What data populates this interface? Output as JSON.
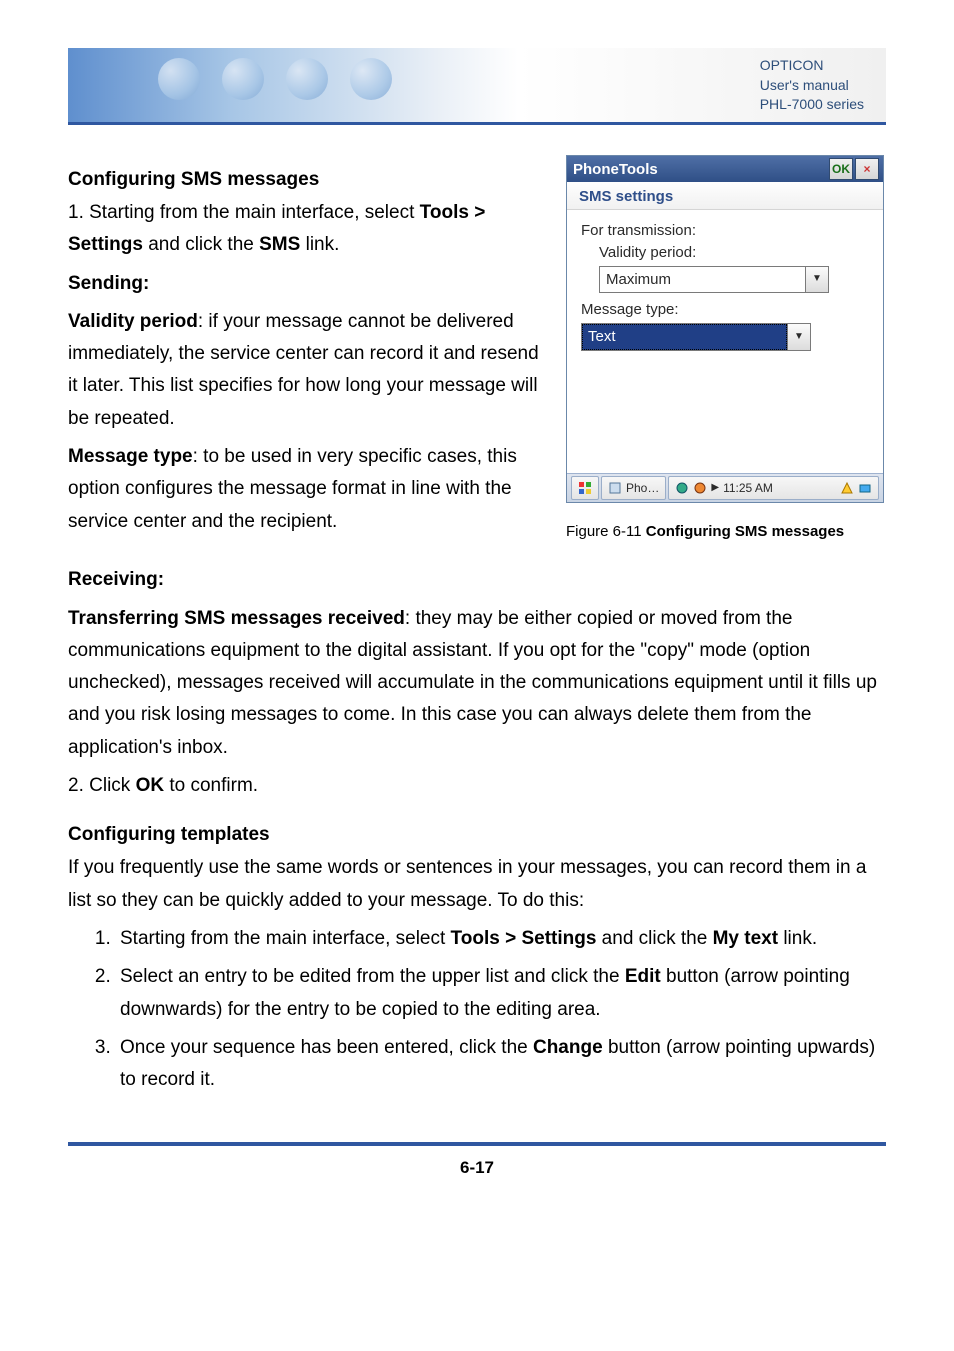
{
  "banner": {
    "line1": "OPTICON",
    "line2": "User's manual",
    "line3": "PHL-7000 series"
  },
  "s1": {
    "heading": "Configuring SMS messages",
    "p1a": "1. Starting from the main interface, select ",
    "p1b": "Tools > Settings",
    "p1c": " and click the ",
    "p1d": "SMS",
    "p1e": " link.",
    "sending": "Sending:",
    "vp_label": "Validity period",
    "vp_text": ": if your message cannot be delivered immediately, the service center can record it and resend it later. This list specifies for how long your message will be repeated.",
    "mt_label": "Message type",
    "mt_text": ": to be used in very specific cases, this option configures the message format in line with the service center and the recipient."
  },
  "shot": {
    "title": "PhoneTools",
    "ok": "OK",
    "close": "×",
    "sub": "SMS settings",
    "for_trans": "For transmission:",
    "validity": "Validity period:",
    "validity_val": "Maximum",
    "msgtype": "Message type:",
    "msgtype_val": "Text",
    "task_app": "Pho…",
    "task_time": "11:25 AM"
  },
  "caption": {
    "prefix": "Figure 6-11 ",
    "bold": "Configuring SMS messages"
  },
  "recv": {
    "heading": "Receiving:",
    "label": "Transferring SMS messages received",
    "text": ": they may be either copied or moved from the communications equipment to the digital assistant. If you opt for the \"copy\" mode (option unchecked), messages received will accumulate in the communications equipment until it fills up and you risk losing messages to come. In this case you can always delete them from the application's inbox.",
    "confirm_a": "2. Click ",
    "confirm_b": "OK",
    "confirm_c": " to confirm."
  },
  "tpl": {
    "heading": "Configuring templates",
    "intro": "If you frequently use the same words or sentences in your messages, you can record them in a list so they can be quickly added to your message. To do this:",
    "li1a": "Starting from the main interface, select ",
    "li1b": "Tools > Settings",
    "li1c": " and click the ",
    "li1d": "My text",
    "li1e": " link.",
    "li2a": "Select an entry to be edited from the upper list and click the ",
    "li2b": "Edit",
    "li2c": " button (arrow pointing downwards) for the entry to be copied to the editing area.",
    "li3a": "Once your sequence has been entered, click the ",
    "li3b": "Change",
    "li3c": " button (arrow pointing upwards) to record it."
  },
  "footer": "6-17"
}
